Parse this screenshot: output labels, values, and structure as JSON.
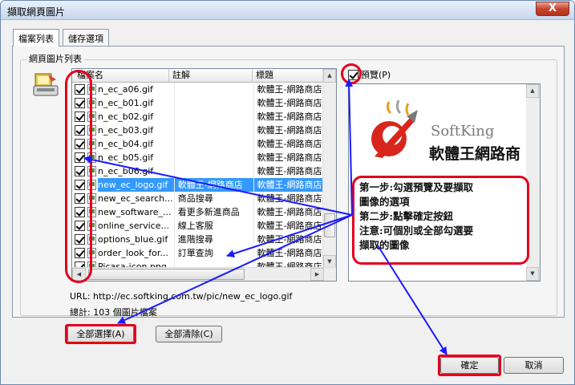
{
  "window": {
    "title": "擷取網頁圖片",
    "close_glyph": "X"
  },
  "tabs": [
    {
      "label": "檔案列表",
      "active": true
    },
    {
      "label": "儲存選項",
      "active": false
    }
  ],
  "group": {
    "label": "網頁圖片列表"
  },
  "list": {
    "columns": [
      "檔案名",
      "註解",
      "標題"
    ],
    "rows": [
      {
        "file": "n_ec_a06.gif",
        "note": "",
        "title": "軟體王-網路商店",
        "checked": true,
        "selected": false
      },
      {
        "file": "n_ec_b01.gif",
        "note": "",
        "title": "軟體王-網路商店",
        "checked": true,
        "selected": false
      },
      {
        "file": "n_ec_b02.gif",
        "note": "",
        "title": "軟體王-網路商店",
        "checked": true,
        "selected": false
      },
      {
        "file": "n_ec_b03.gif",
        "note": "",
        "title": "軟體王-網路商店",
        "checked": true,
        "selected": false
      },
      {
        "file": "n_ec_b04.gif",
        "note": "",
        "title": "軟體王-網路商店",
        "checked": true,
        "selected": false
      },
      {
        "file": "n_ec_b05.gif",
        "note": "",
        "title": "軟體王-網路商店",
        "checked": true,
        "selected": false
      },
      {
        "file": "n_ec_b06.gif",
        "note": "",
        "title": "軟體王-網路商店",
        "checked": true,
        "selected": false
      },
      {
        "file": "new_ec_logo.gif",
        "note": "軟體王-網路商店",
        "title": "軟體王-網路商店",
        "checked": true,
        "selected": true
      },
      {
        "file": "new_ec_search...",
        "note": "商品搜尋",
        "title": "軟體王-網路商店",
        "checked": true,
        "selected": false
      },
      {
        "file": "new_software_...",
        "note": "看更多新進商品",
        "title": "軟體王-網路商店",
        "checked": true,
        "selected": false
      },
      {
        "file": "online_service...",
        "note": "線上客服",
        "title": "軟體王-網路商店",
        "checked": true,
        "selected": false
      },
      {
        "file": "options_blue.gif",
        "note": "進階搜尋",
        "title": "軟體王-網路商店",
        "checked": true,
        "selected": false
      },
      {
        "file": "order_look_for...",
        "note": "訂單查詢",
        "title": "軟體王-網路商店",
        "checked": true,
        "selected": false
      },
      {
        "file": "Picasa-icon.png",
        "note": "",
        "title": "軟體王-網路商店",
        "checked": true,
        "selected": false
      }
    ]
  },
  "preview": {
    "label": "預覽(P)",
    "checked": true,
    "logo_en": "SoftKing",
    "logo_zh": "軟體王網路商"
  },
  "info": {
    "url": "URL: http://ec.softking.com.tw/pic/new_ec_logo.gif",
    "total": "總計: 103 個圖片檔案"
  },
  "buttons": {
    "select_all": "全部選擇(A)",
    "clear_all": "全部清除(C)",
    "ok": "確定",
    "cancel": "取消"
  },
  "annotation": {
    "lines": [
      "第一步:勾選預覽及要擷取",
      "圖像的選項",
      "第二步:點擊確定按鈕",
      "注意:可個別或全部勾選要",
      "擷取的圖像"
    ]
  },
  "colors": {
    "highlight": "#e3001b",
    "arrow": "#1a1aff",
    "selection": "#3399ff"
  }
}
